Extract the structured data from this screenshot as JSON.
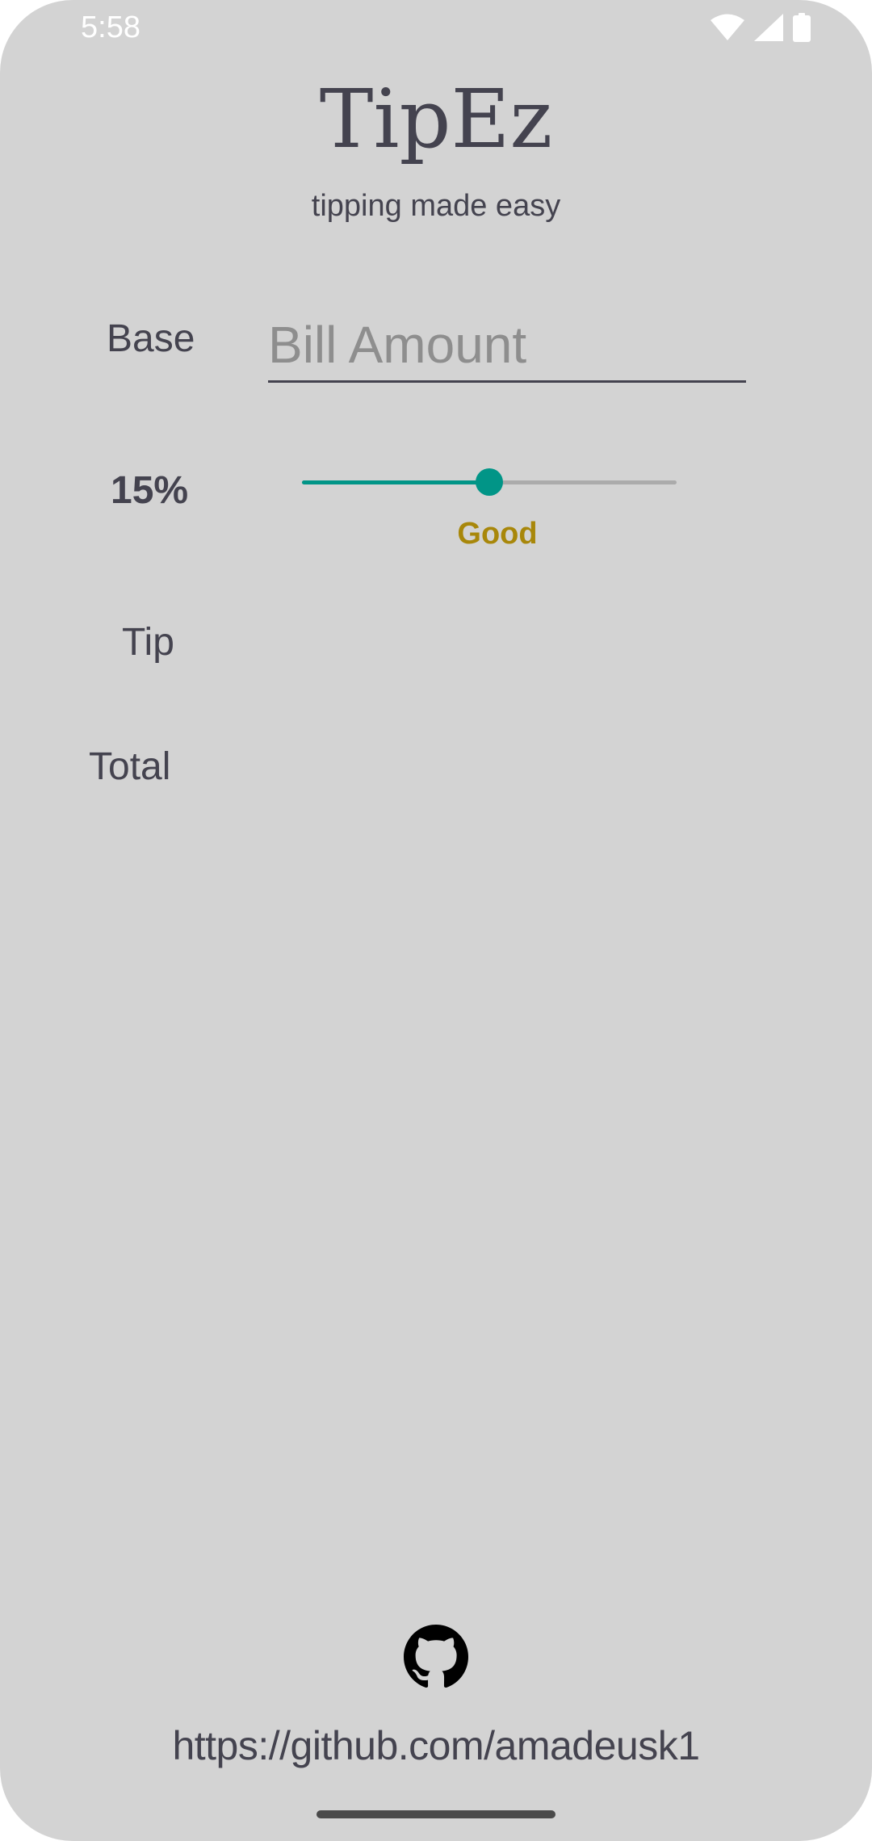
{
  "status_bar": {
    "time": "5:58",
    "icons": [
      "wifi-icon",
      "cellular-signal-icon",
      "battery-icon"
    ],
    "icon_color": "#ffffff"
  },
  "header": {
    "title": "TipEz",
    "subtitle": "tipping made easy"
  },
  "form": {
    "base_label": "Base",
    "bill_placeholder": "Bill Amount",
    "bill_value": "",
    "percent_label": "15%",
    "tip_label": "Tip",
    "total_label": "Total"
  },
  "slider": {
    "value": 15,
    "min": 0,
    "max": 30,
    "description": "Good",
    "active_color": "#019587",
    "inactive_color": "#ababab"
  },
  "footer": {
    "icon": "github-icon",
    "link_text": "https://github.com/amadeusk1"
  },
  "colors": {
    "background": "#d3d3d3",
    "text": "#44434f",
    "accent": "#019587",
    "description": "#a8870a"
  }
}
